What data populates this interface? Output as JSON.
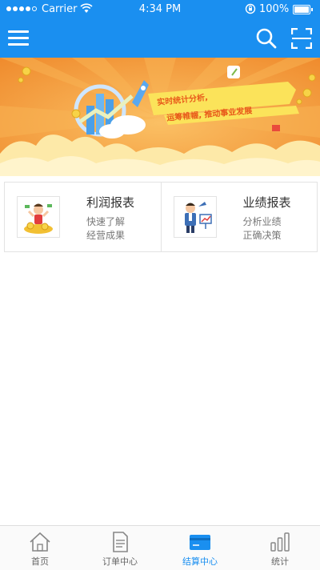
{
  "status_bar": {
    "carrier": "Carrier",
    "time": "4:34 PM",
    "battery": "100%"
  },
  "header": {
    "accent_color": "#1a8ff0",
    "left_icon": "menu-icon",
    "right_icons": [
      "search-icon",
      "scan-icon"
    ]
  },
  "banner": {
    "line1": "实时统计分析,",
    "line2": "运筹帷幄, 推动事业发展"
  },
  "reports": [
    {
      "title": "利润报表",
      "desc1": "快速了解",
      "desc2": "经营成果",
      "icon": "money-pile-icon"
    },
    {
      "title": "业绩报表",
      "desc1": "分析业绩",
      "desc2": "正确决策",
      "icon": "businessman-chart-icon"
    }
  ],
  "tabs": [
    {
      "label": "首页",
      "icon": "home-icon",
      "active": false
    },
    {
      "label": "订单中心",
      "icon": "document-icon",
      "active": false
    },
    {
      "label": "结算中心",
      "icon": "card-icon",
      "active": true
    },
    {
      "label": "统计",
      "icon": "bar-chart-icon",
      "active": false
    }
  ]
}
